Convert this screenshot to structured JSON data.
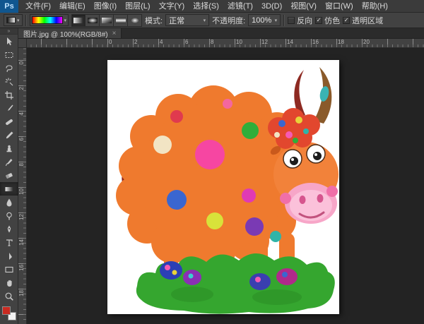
{
  "titlebar": {
    "logo": "Ps",
    "menus": [
      "文件(F)",
      "编辑(E)",
      "图像(I)",
      "图层(L)",
      "文字(Y)",
      "选择(S)",
      "滤镜(T)",
      "3D(D)",
      "视图(V)",
      "窗口(W)",
      "帮助(H)"
    ]
  },
  "options_bar": {
    "mode_label": "模式:",
    "mode_value": "正常",
    "opacity_label": "不透明度:",
    "opacity_value": "100%",
    "reverse_label": "反向",
    "dither_label": "仿色",
    "transparency_label": "透明区域",
    "reverse_check": "",
    "dither_check": "✓",
    "transparency_check": "✓"
  },
  "document_tab": {
    "title": "图片.jpg @ 100%(RGB/8#)",
    "close": "×"
  },
  "ruler": {
    "horizontal": [
      "0",
      "2",
      "4",
      "6",
      "8",
      "10",
      "12",
      "14",
      "16",
      "18",
      "20"
    ],
    "vertical": [
      "0",
      "2",
      "4",
      "6",
      "8",
      "10",
      "12",
      "14",
      "16",
      "18"
    ]
  },
  "toolbar": {
    "collapse_glyph": "»",
    "tools": [
      "move-tool",
      "rectangular-marquee-tool",
      "lasso-tool",
      "magic-wand-tool",
      "crop-tool",
      "eyedropper-tool",
      "healing-brush-tool",
      "brush-tool",
      "clone-stamp-tool",
      "history-brush-tool",
      "eraser-tool",
      "gradient-tool",
      "blur-tool",
      "dodge-tool",
      "pen-tool",
      "type-tool",
      "path-selection-tool",
      "shape-tool",
      "hand-tool",
      "zoom-tool"
    ],
    "selected_tool": "gradient-tool"
  },
  "icons": {
    "caret_down": "▾"
  },
  "colors": {
    "ui_background": "#424242",
    "pasteboard": "#232323",
    "logo_blue": "#10568f",
    "foreground_swatch": "#c92a21",
    "cow_body_orange": "#ef7a2e",
    "cow_head_orange": "#f2823a",
    "muzzle_pink": "#f7a6c8",
    "grass_green": "#35a62f",
    "flower_red": "#e2472e",
    "horn_brown": "#8a5a2a",
    "flame_maroon": "#8f2218"
  },
  "canvas_image": {
    "description": "Cartoon orange fluffy ox with colorful polka dots, pink muzzle, brown horns, flame-tipped tail, standing on green grass"
  }
}
